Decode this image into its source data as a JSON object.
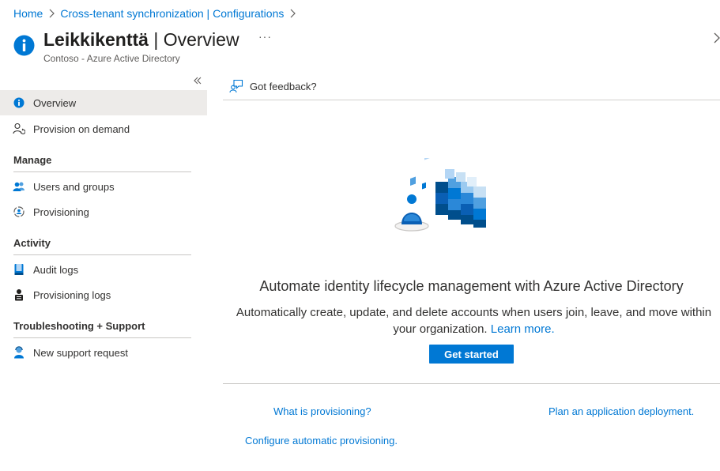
{
  "breadcrumb": {
    "items": [
      "Home",
      "Cross-tenant synchronization | Configurations"
    ]
  },
  "header": {
    "title_main": "Leikkikenttä",
    "title_sep": " | ",
    "title_page": "Overview",
    "subtitle": "Contoso - Azure Active Directory",
    "more_label": "···"
  },
  "sidebar": {
    "collapse_glyph": "«",
    "items": {
      "overview": "Overview",
      "provision_on_demand": "Provision on demand",
      "users_and_groups": "Users and groups",
      "provisioning": "Provisioning",
      "audit_logs": "Audit logs",
      "provisioning_logs": "Provisioning logs",
      "new_support_request": "New support request"
    },
    "sections": {
      "manage": "Manage",
      "activity": "Activity",
      "troubleshooting": "Troubleshooting + Support"
    }
  },
  "main": {
    "feedback": "Got feedback?",
    "headline": "Automate identity lifecycle management with Azure Active Directory",
    "description": "Automatically create, update, and delete accounts when users join, leave, and move within your organization.",
    "learn_more": "Learn more.",
    "get_started": "Get started",
    "links": {
      "what_is": "What is provisioning?",
      "plan": "Plan an application deployment.",
      "configure": "Configure automatic provisioning."
    }
  },
  "colors": {
    "accent": "#0078d4",
    "active_bg": "#edebe9",
    "text": "#323130"
  }
}
